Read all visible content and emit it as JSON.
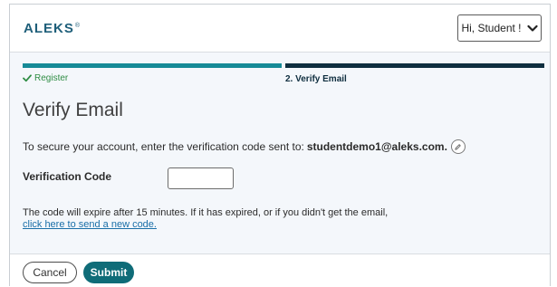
{
  "header": {
    "logo_text": "ALEKS",
    "logo_mark": "®",
    "user_button_label": "Hi, Student !",
    "user_button_icon": "chevron-down-icon"
  },
  "progress": {
    "step1_label": "Register",
    "step1_icon": "checkmark-icon",
    "step2_label": "2. Verify Email",
    "completed_color": "#168a97",
    "current_color": "#0f2e3f"
  },
  "main": {
    "title": "Verify Email",
    "instruction": "To secure your account, enter the verification code sent to:",
    "email": "studentdemo1@aleks.com.",
    "edit_icon": "pencil-icon",
    "code_label": "Verification Code",
    "code_value": "",
    "expire_text": "The code will expire after 15 minutes. If it has expired, or if you didn't get the email,",
    "resend_link": "click here to send a new code."
  },
  "footer": {
    "cancel_label": "Cancel",
    "submit_label": "Submit",
    "submit_color": "#0f6c78"
  }
}
